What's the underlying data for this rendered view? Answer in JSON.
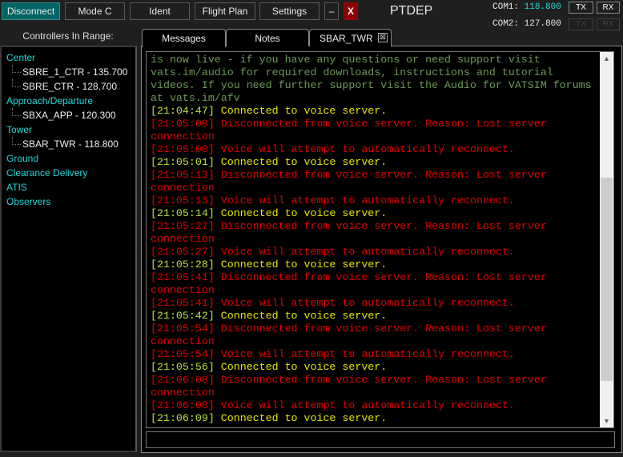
{
  "toolbar": {
    "disconnect": "Disconnect",
    "mode_c": "Mode C",
    "ident": "Ident",
    "flight_plan": "Flight Plan",
    "settings": "Settings",
    "minimize": "–",
    "close": "X"
  },
  "callsign": "PTDEP",
  "radios": [
    {
      "label": "COM1:",
      "freq": "118.800",
      "tx": "TX",
      "rx": "RX",
      "active": true
    },
    {
      "label": "COM2:",
      "freq": "127.800",
      "tx": "TX",
      "rx": "RX",
      "active": false
    }
  ],
  "controllers": {
    "title": "Controllers In Range:",
    "groups": [
      {
        "name": "Center",
        "items": [
          "SBRE_1_CTR - 135.700",
          "SBRE_CTR - 128.700"
        ]
      },
      {
        "name": "Approach/Departure",
        "items": [
          "SBXA_APP - 120.300"
        ]
      },
      {
        "name": "Tower",
        "items": [
          "SBAR_TWR - 118.800"
        ]
      },
      {
        "name": "Ground",
        "items": []
      },
      {
        "name": "Clearance Delivery",
        "items": []
      },
      {
        "name": "ATIS",
        "items": []
      },
      {
        "name": "Observers",
        "items": []
      }
    ]
  },
  "tabs": [
    {
      "label": "Messages",
      "active": true
    },
    {
      "label": "Notes"
    },
    {
      "label": "SBAR_TWR",
      "closable": true
    }
  ],
  "close_tab_icon": "⊠",
  "scroll": {
    "position_fraction": 0.55,
    "visible_fraction": 0.58
  },
  "colors": {
    "info": "#6d9a5a",
    "ok": "#e6e600",
    "error": "#e00000",
    "accent": "#22d6d6"
  },
  "messages": [
    {
      "type": "info",
      "ts": "",
      "text": "is now live - if you have any questions or need support visit vats.im/audio for required downloads, instructions and tutorial videos. If you need further support visit the Audio for VATSIM forums at vats.im/afv"
    },
    {
      "type": "ok",
      "ts": "[21:04:47]",
      "text": "Connected to voice server."
    },
    {
      "type": "err",
      "ts": "[21:05:00]",
      "text": "Disconnected from voice server. Reason: Lost server connection"
    },
    {
      "type": "err",
      "ts": "[21:05:00]",
      "text": "Voice will attempt to automatically reconnect."
    },
    {
      "type": "ok",
      "ts": "[21:05:01]",
      "text": "Connected to voice server."
    },
    {
      "type": "err",
      "ts": "[21:05:13]",
      "text": "Disconnected from voice server. Reason: Lost server connection"
    },
    {
      "type": "err",
      "ts": "[21:05:13]",
      "text": "Voice will attempt to automatically reconnect."
    },
    {
      "type": "ok",
      "ts": "[21:05:14]",
      "text": "Connected to voice server."
    },
    {
      "type": "err",
      "ts": "[21:05:27]",
      "text": "Disconnected from voice server. Reason: Lost server connection"
    },
    {
      "type": "err",
      "ts": "[21:05:27]",
      "text": "Voice will attempt to automatically reconnect."
    },
    {
      "type": "ok",
      "ts": "[21:05:28]",
      "text": "Connected to voice server."
    },
    {
      "type": "err",
      "ts": "[21:05:41]",
      "text": "Disconnected from voice server. Reason: Lost server connection"
    },
    {
      "type": "err",
      "ts": "[21:05:41]",
      "text": "Voice will attempt to automatically reconnect."
    },
    {
      "type": "ok",
      "ts": "[21:05:42]",
      "text": "Connected to voice server."
    },
    {
      "type": "err",
      "ts": "[21:05:54]",
      "text": "Disconnected from voice server. Reason: Lost server connection"
    },
    {
      "type": "err",
      "ts": "[21:05:54]",
      "text": "Voice will attempt to automatically reconnect."
    },
    {
      "type": "ok",
      "ts": "[21:05:56]",
      "text": "Connected to voice server."
    },
    {
      "type": "err",
      "ts": "[21:06:08]",
      "text": "Disconnected from voice server. Reason: Lost server connection"
    },
    {
      "type": "err",
      "ts": "[21:06:08]",
      "text": "Voice will attempt to automatically reconnect."
    },
    {
      "type": "ok",
      "ts": "[21:06:09]",
      "text": "Connected to voice server."
    }
  ],
  "input": {
    "value": ""
  }
}
